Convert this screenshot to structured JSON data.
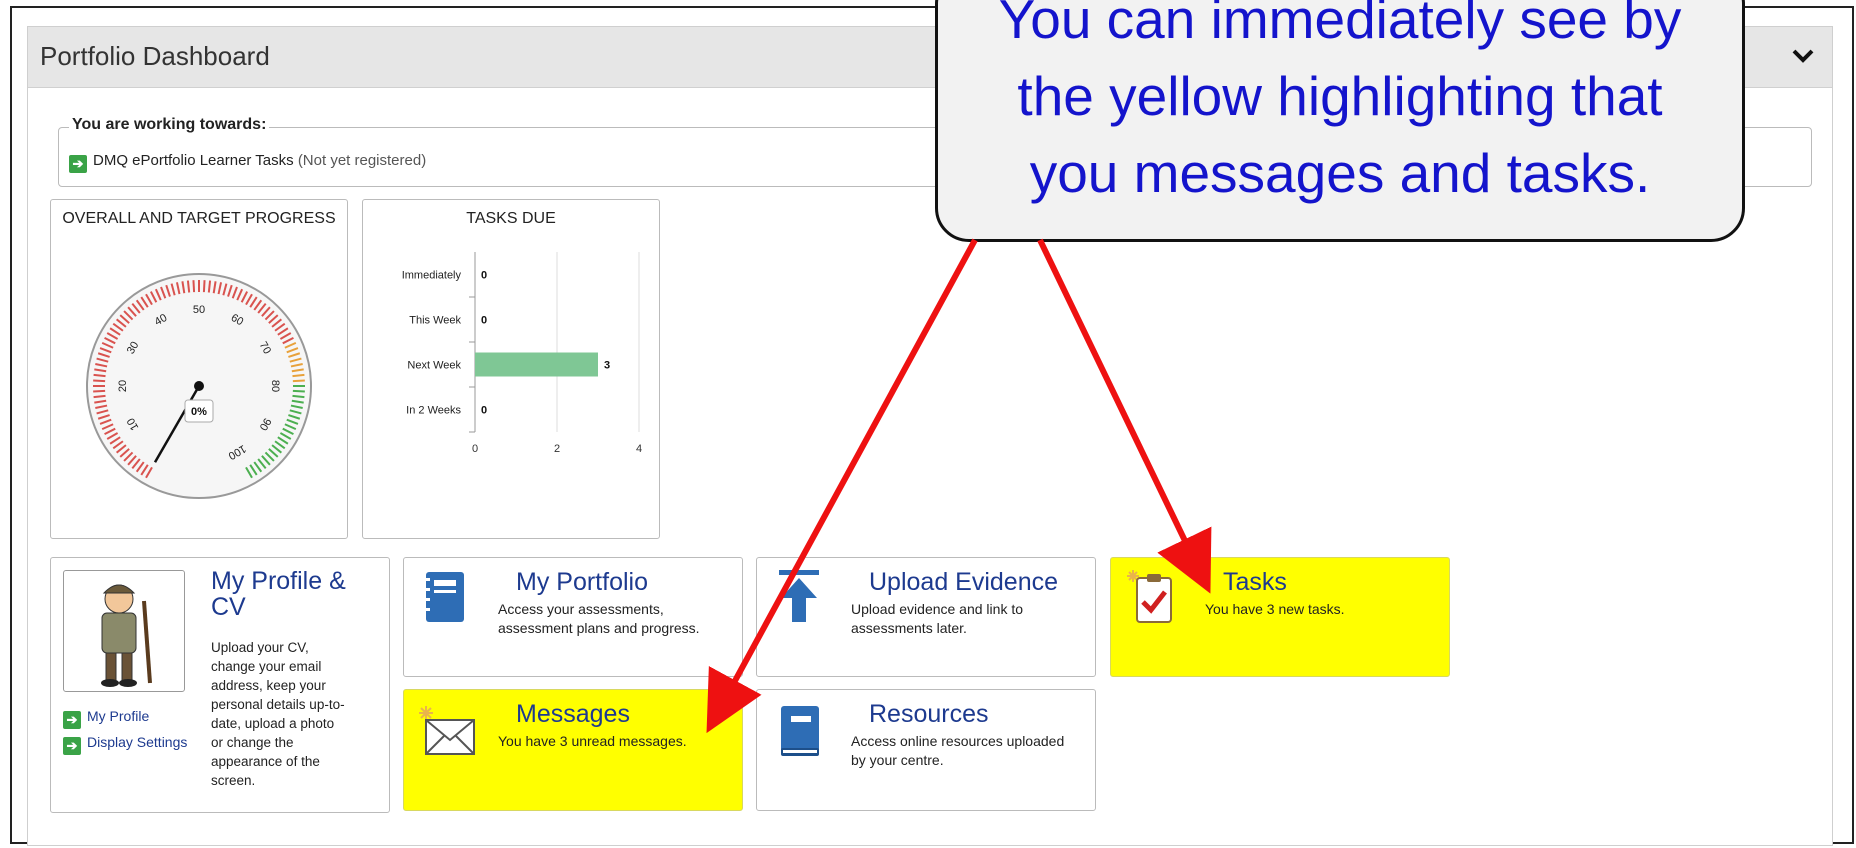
{
  "panel": {
    "title": "Portfolio Dashboard"
  },
  "working": {
    "legend": "You are working towards:",
    "course": "DMQ ePortfolio Learner Tasks",
    "status": "(Not yet registered)"
  },
  "gauge": {
    "title": "OVERALL AND TARGET PROGRESS",
    "value_label": "0%",
    "value": 0,
    "ticks": [
      "10",
      "20",
      "30",
      "40",
      "50",
      "60",
      "70",
      "80",
      "90",
      "100"
    ]
  },
  "tasks_due": {
    "title": "TASKS DUE"
  },
  "chart_data": {
    "type": "bar",
    "orientation": "horizontal",
    "title": "TASKS DUE",
    "categories": [
      "Immediately",
      "This Week",
      "Next Week",
      "In 2 Weeks"
    ],
    "values": [
      0,
      0,
      3,
      0
    ],
    "xlim": [
      0,
      4
    ],
    "xticks": [
      "0",
      "2",
      "4"
    ],
    "bar_color": "#7fc795",
    "grid": true
  },
  "tiles": {
    "profile": {
      "title": "My Profile & CV",
      "desc": [
        "Upload your CV,",
        "change your email",
        "address, keep your",
        "personal details up-to-",
        "date, upload a photo",
        "or change the",
        "appearance of the",
        "screen."
      ],
      "link_profile": "My Profile",
      "link_display": "Display Settings"
    },
    "portfolio": {
      "title": "My Portfolio",
      "desc": [
        "Access your assessments,",
        "assessment plans and progress."
      ]
    },
    "upload": {
      "title": "Upload Evidence",
      "desc": [
        "Upload evidence and link to",
        "assessments later."
      ]
    },
    "tasks": {
      "title": "Tasks",
      "desc": [
        "You have 3 new tasks."
      ]
    },
    "messages": {
      "title": "Messages",
      "desc": [
        "You have 3 unread messages."
      ]
    },
    "resources": {
      "title": "Resources",
      "desc": [
        "Access online resources uploaded",
        "by your centre."
      ]
    }
  },
  "callout": {
    "lines": [
      "You can immediately see by",
      "the yellow highlighting that",
      "you messages and tasks."
    ]
  },
  "colors": {
    "highlight": "#ffff00",
    "title_blue": "#1d3a8f",
    "callout_text": "#1414cc",
    "arrow_red": "#ee1111"
  },
  "icons": [
    "chevron-down-icon",
    "go-arrow-icon",
    "notebook-icon",
    "upload-arrow-icon",
    "clipboard-check-icon",
    "envelope-icon",
    "book-icon",
    "avatar-cartoon"
  ]
}
